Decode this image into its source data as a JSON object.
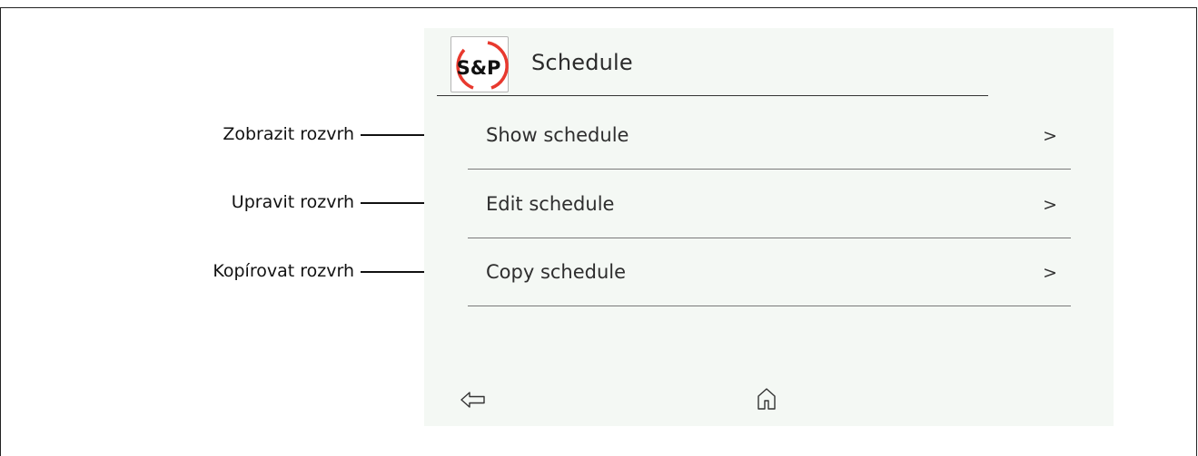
{
  "header": {
    "title": "Schedule",
    "logo_text": "S&P"
  },
  "menu": [
    {
      "label": "Show schedule",
      "chevron": ">"
    },
    {
      "label": "Edit schedule",
      "chevron": ">"
    },
    {
      "label": "Copy schedule",
      "chevron": ">"
    }
  ],
  "annotations": [
    "Zobrazit rozvrh",
    "Upravit rozvrh",
    "Kopírovat rozvrh"
  ],
  "nav": {
    "back_icon": "arrow-left-outline-icon",
    "home_icon": "home-outline-icon"
  },
  "colors": {
    "screen_bg": "#f4f8f4",
    "logo_red": "#e8392e",
    "text": "#2e2e2e"
  }
}
